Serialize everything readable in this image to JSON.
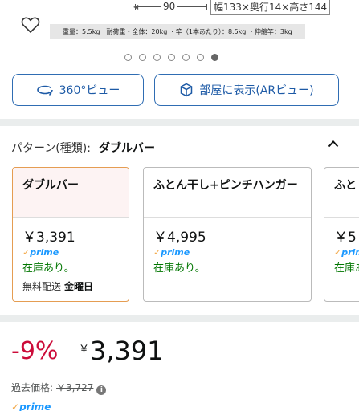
{
  "image_strip": {
    "dim_width_label": "90",
    "dim_box_label": "幅133×奥行14×高さ144",
    "spec_text": "重量：5.5kg　耐荷重・全体：20kg ・竿（1本あたり）：8.5kg ・伸縮竿：3kg"
  },
  "carousel": {
    "count": 7,
    "active_index": 6
  },
  "view_buttons": {
    "view_360_label": "360°ビュー",
    "ar_label": "部屋に表示(ARビュー)"
  },
  "pattern": {
    "label": "パターン(種類):",
    "selected": "ダブルバー"
  },
  "variants": [
    {
      "title": "ダブルバー",
      "price": "￥3,391",
      "prime": "prime",
      "stock": "在庫あり。",
      "ship_label": "無料配送",
      "ship_day": "金曜日"
    },
    {
      "title": "ふとん干し+ピンチハンガー",
      "price": "￥4,995",
      "prime": "prime",
      "stock": "在庫あり。"
    },
    {
      "title": "ふと",
      "price": "￥5",
      "prime": "prime",
      "stock": "在庫あ"
    }
  ],
  "price_block": {
    "discount": "-9%",
    "currency": "￥",
    "price": "3,391",
    "list_price_label": "過去価格:",
    "list_price": "￥3,727",
    "prime": "prime"
  },
  "colors": {
    "accent_blue": "#2f6db3",
    "discount_red": "#cc0c39",
    "stock_green": "#007600",
    "prime_blue": "#1a98ff",
    "selected_border": "#e59d52"
  }
}
